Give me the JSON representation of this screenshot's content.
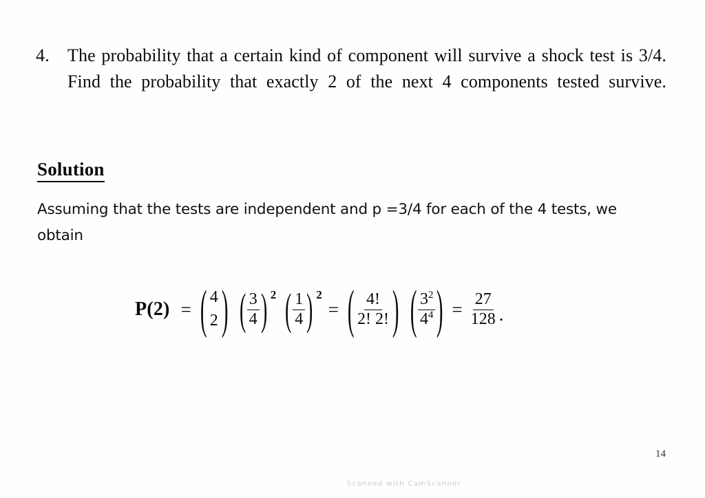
{
  "document": {
    "page_number": "14",
    "watermark": "Scanned with CamScanner",
    "background_color": "#fffefd",
    "text_color": "#0b0b0b"
  },
  "problem": {
    "number": "4.",
    "text": "The probability that a certain kind of component will survive a shock test is 3/4. Find the probability that exactly 2 of the next 4 components tested survive."
  },
  "solution": {
    "heading": "Solution",
    "body": "Assuming that the tests are independent and p =3/4 for each of the 4 tests, we obtain",
    "formula": {
      "plain": "P(2) = (4 choose 2) (3/4)^2 (1/4)^2 = ( 4! / (2! 2!) ) ( 3^2 / 4^4 ) = 27/128.",
      "lhs": "P(2)",
      "equals_1": "=",
      "equals_2": "=",
      "equals_3": "=",
      "binomial": {
        "n": "4",
        "k": "2"
      },
      "term_p": {
        "numerator": "3",
        "denominator": "4",
        "exponent": "2"
      },
      "term_q": {
        "numerator": "1",
        "denominator": "4",
        "exponent": "2"
      },
      "factorial_term": {
        "numerator": "4!",
        "denominator": "2! 2!"
      },
      "power_term": {
        "numerator_base": "3",
        "numerator_exp": "2",
        "denominator_base": "4",
        "denominator_exp": "4"
      },
      "result": {
        "numerator": "27",
        "denominator": "128"
      },
      "period": ".",
      "open_paren": "(",
      "close_paren": ")"
    }
  }
}
